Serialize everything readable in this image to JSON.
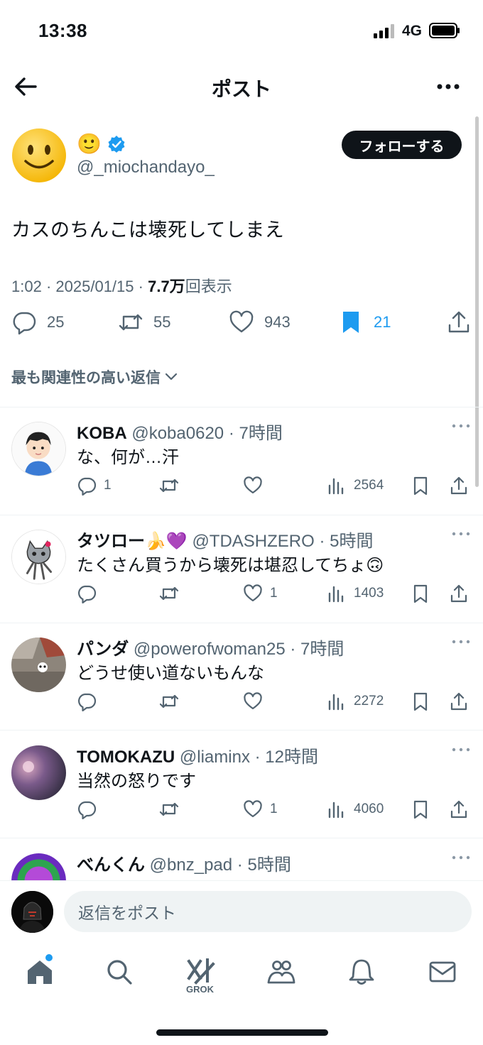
{
  "status_bar": {
    "time": "13:38",
    "network": "4G"
  },
  "nav": {
    "title": "ポスト"
  },
  "post": {
    "author_display_name": "🙂",
    "author_handle": "@_miochandayo_",
    "follow_label": "フォローする",
    "text": "カスのちんこは壊死してしまえ",
    "time": "1:02",
    "date": "2025/01/15",
    "views_value": "7.7万",
    "views_suffix": "回表示",
    "replies": "25",
    "reposts": "55",
    "likes": "943",
    "bookmarks": "21"
  },
  "sort_label": "最も関連性の高い返信",
  "replies": [
    {
      "name": "KOBA",
      "handle": "@koba0620",
      "time": "7時間",
      "text": "な、何が…汗",
      "replies": "1",
      "likes": "",
      "views": "2564"
    },
    {
      "name": "タツロー🍌💜",
      "handle": "@TDASHZERO",
      "time": "5時間",
      "text": "たくさん買うから壊死は堪忍してちょ🙃",
      "replies": "",
      "likes": "1",
      "views": "1403"
    },
    {
      "name": "パンダ",
      "handle": "@powerofwoman25",
      "time": "7時間",
      "text": "どうせ使い道ないもんな",
      "replies": "",
      "likes": "",
      "views": "2272"
    },
    {
      "name": "TOMOKAZU",
      "handle": "@liaminx",
      "time": "12時間",
      "text": "当然の怒りです",
      "replies": "",
      "likes": "1",
      "views": "4060"
    },
    {
      "name": "べんくん",
      "handle": "@bnz_pad",
      "time": "5時間",
      "text": "",
      "replies": "",
      "likes": "",
      "views": ""
    }
  ],
  "composer": {
    "placeholder": "返信をポスト"
  },
  "tabs": {
    "grok_label": "GROK"
  },
  "colors": {
    "accent": "#1d9bf0",
    "text": "#0f1419",
    "secondary": "#536471"
  }
}
